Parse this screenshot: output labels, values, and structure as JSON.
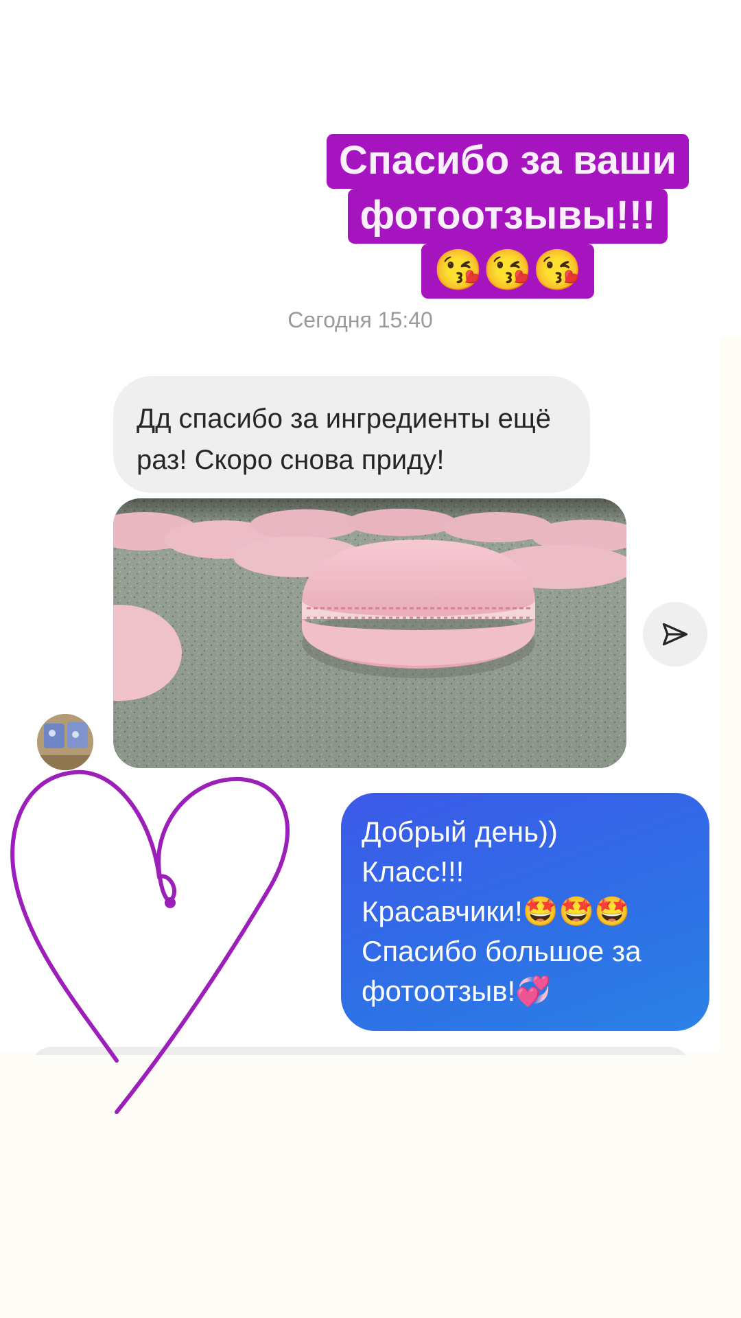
{
  "story": {
    "caption_line1": "Спасибо за ваши",
    "caption_line2": "фотоотзывы!!!",
    "caption_emoji": "😘😘😘"
  },
  "chat": {
    "timestamp": "Сегодня 15:40",
    "incoming_message": "Дд спасибо за ингредиенты ещё раз! Скоро снова приду!",
    "outgoing_message": {
      "line1": "Добрый день))",
      "line2": "Класс!!!",
      "line3": "Красавчики!🤩🤩🤩",
      "line4": "Спасибо большое за",
      "line5": "фотоотзыв!💞"
    }
  },
  "icons": {
    "share": "send-icon",
    "heart": "heart-drawing"
  },
  "colors": {
    "caption_bg": "#a614c0",
    "caption_text": "#fbeefd",
    "incoming_bubble": "#efefef",
    "outgoing_bubble_start": "#3c59e8",
    "outgoing_bubble_end": "#2a82e6",
    "heart_stroke": "#9b1fb8"
  }
}
